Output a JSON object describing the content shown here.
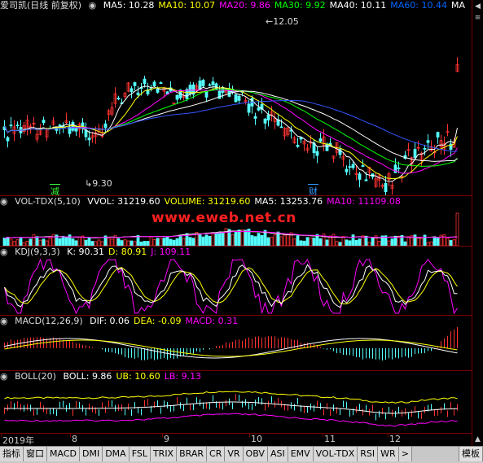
{
  "main": {
    "title": "爱司凯(日线 前复权)",
    "ma_items": [
      {
        "label": "MA5: 10.28",
        "color": "#ffffff"
      },
      {
        "label": "MA10: 10.07",
        "color": "#ffff00"
      },
      {
        "label": "MA20: 9.86",
        "color": "#ff00ff"
      },
      {
        "label": "MA30: 9.92",
        "color": "#00ff00"
      },
      {
        "label": "MA40: 10.11",
        "color": "#ffffff"
      },
      {
        "label": "MA60: 10.44",
        "color": "#0066ff"
      },
      {
        "label": "MA",
        "color": "#ffffff"
      }
    ],
    "high_label": "12.05",
    "low_label": "9.30",
    "tag_jian": "减",
    "tag_cai": "财"
  },
  "volume": {
    "title": "VOL-TDX(5,10)",
    "items": [
      {
        "label": "VVOL: 31219.60",
        "color": "#ffffff"
      },
      {
        "label": "VOLUME: 31219.60",
        "color": "#ffff00"
      },
      {
        "label": "MA5: 13253.76",
        "color": "#ffffff"
      },
      {
        "label": "MA10: 11109.08",
        "color": "#ff00ff"
      }
    ]
  },
  "watermark": "www.eweb.net.cn",
  "kdj": {
    "title": "KDJ(9,3,3)",
    "items": [
      {
        "label": "K: 90.31",
        "color": "#ffffff"
      },
      {
        "label": "D: 80.91",
        "color": "#ffff00"
      },
      {
        "label": "J: 109.11",
        "color": "#ff00ff"
      }
    ]
  },
  "macd": {
    "title": "MACD(12,26,9)",
    "items": [
      {
        "label": "DIF: 0.06",
        "color": "#ffffff"
      },
      {
        "label": "DEA: -0.09",
        "color": "#ffff00"
      },
      {
        "label": "MACD: 0.31",
        "color": "#ff00ff"
      }
    ]
  },
  "boll": {
    "title": "BOLL(20)",
    "items": [
      {
        "label": "BOLL: 9.86",
        "color": "#ffffff"
      },
      {
        "label": "UB: 10.60",
        "color": "#ffff00"
      },
      {
        "label": "LB: 9.13",
        "color": "#ff00ff"
      }
    ]
  },
  "axis_labels": [
    "2019年",
    "8",
    "9",
    "10",
    "11",
    "12"
  ],
  "tabs": [
    "指标",
    "窗口",
    "MACD",
    "DMI",
    "DMA",
    "FSL",
    "TRIX",
    "BRAR",
    "CR",
    "VR",
    "OBV",
    "ASI",
    "EMV",
    "VOL-TDX",
    "RSI",
    "WR",
    ">"
  ],
  "tab_right": "模板",
  "right_buttons": [
    "◀",
    "≡",
    "▲"
  ],
  "colors": {
    "up": "#ff3232",
    "down": "#54ffff",
    "grid": "#7a0000"
  }
}
